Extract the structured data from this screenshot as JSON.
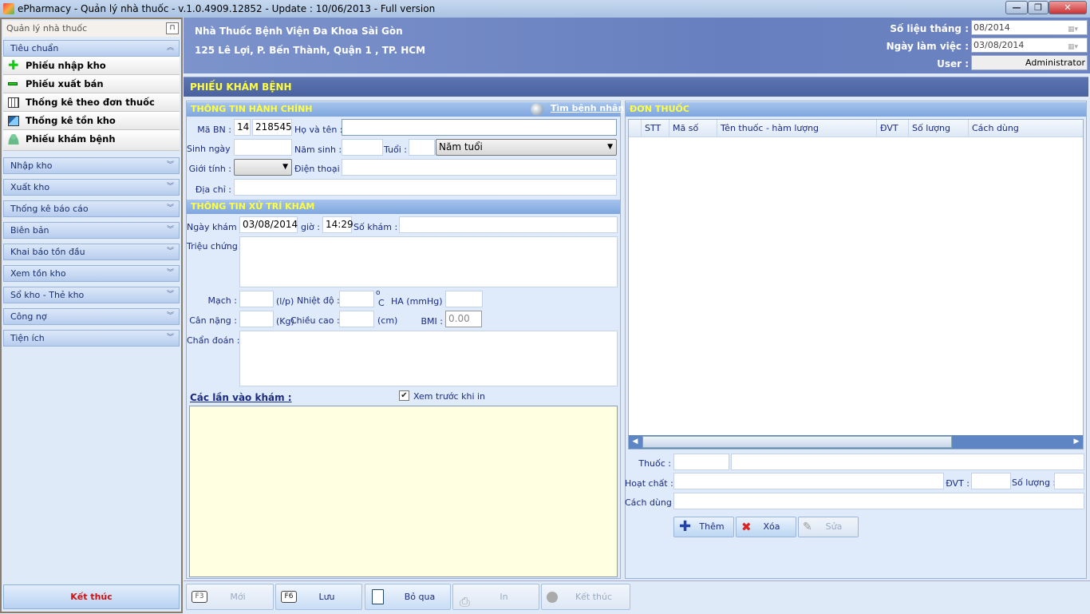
{
  "window": {
    "title": "ePharmacy - Quản lý nhà thuốc - v.1.0.4909.12852 - Update : 10/06/2013 - Full version",
    "minimize": "—",
    "restore": "❐",
    "close": "✕"
  },
  "sidebar": {
    "title": "Quản lý nhà thuốc",
    "pin": "⊓",
    "expanded_group": "Tiêu chuẩn",
    "items": [
      {
        "label": "Phiếu nhập kho",
        "icon": "plus-icon"
      },
      {
        "label": "Phiếu xuất bán",
        "icon": "minus-icon"
      },
      {
        "label": "Thống kê theo đơn thuốc",
        "icon": "table-icon"
      },
      {
        "label": "Thống kê tồn kho",
        "icon": "inventory-icon"
      },
      {
        "label": "Phiếu khám bệnh",
        "icon": "person-icon"
      }
    ],
    "groups": [
      "Nhập kho",
      "Xuất kho",
      "Thống kê báo cáo",
      "Biên bản",
      "Khai báo tồn đầu",
      "Xem tồn kho",
      "Sổ kho - Thẻ kho",
      "Công nợ",
      "Tiện ích"
    ],
    "exit": "Kết thúc"
  },
  "header": {
    "name": "Nhà Thuốc Bệnh Viện Đa Khoa Sài Gòn",
    "address": "125 Lê Lợi, P. Bến Thành, Quận 1 , TP. HCM",
    "month_label": "Số liệu tháng :",
    "month_value": "08/2014",
    "workday_label": "Ngày làm việc :",
    "workday_value": "03/08/2014",
    "user_label": "User :",
    "user_value": "Administrator"
  },
  "form_title": "PHIẾU KHÁM BỆNH",
  "admin": {
    "title": "THÔNG TIN HÀNH CHÍNH",
    "search": "Tìm bệnh nhân",
    "ma_bn_label": "Mã BN :",
    "ma_bn_prefix": "14",
    "ma_bn": "218545",
    "name_label": "Họ và tên :",
    "name": "",
    "dob_label": "Sinh ngày :",
    "yob_label": "Năm sinh :",
    "age_label": "Tuổi :",
    "age_unit": "Năm tuổi",
    "gender_label": "Giới tính :",
    "gender": "",
    "phone_label": "Điện thoại :",
    "address_label": "Địa chỉ :"
  },
  "exam": {
    "title": "THÔNG TIN XỬ TRÍ KHÁM",
    "date_label": "Ngày khám :",
    "date": "03/08/2014",
    "time_label": "giờ :",
    "time": "14:29",
    "no_label": "Số khám :",
    "symptom_label": "Triệu chứng :",
    "pulse_label": "Mạch :",
    "pulse_unit": "(l/p)",
    "temp_label": "Nhiệt độ :",
    "temp_unit_o": "o",
    "temp_unit_c": "C",
    "bp_label": "HA (mmHg) :",
    "weight_label": "Cân nặng :",
    "weight_unit": "(Kg)",
    "height_label": "Chiều cao :",
    "height_unit": "(cm)",
    "bmi_label": "BMI :",
    "bmi": "0.00",
    "diag_label": "Chẩn đoán :",
    "visits_label": "Các lần vào khám :",
    "preview_label": "Xem trước khi in",
    "preview_checked": true
  },
  "prescription": {
    "title": "ĐƠN THUỐC",
    "columns": [
      "",
      "STT",
      "Mã số",
      "Tên thuốc - hàm lượng",
      "ĐVT",
      "Số lượng",
      "Cách dùng"
    ],
    "rows": [],
    "drug_label": "Thuốc :",
    "ingredient_label": "Hoạt chất :",
    "unit_label": "ĐVT :",
    "qty_label": "Số lượng :",
    "usage_label": "Cách dùng :",
    "add": "Thêm",
    "delete": "Xóa",
    "edit": "Sửa"
  },
  "toolbar": {
    "new_key": "F3",
    "new": "Mới",
    "save_key": "F6",
    "save": "Lưu",
    "skip": "Bỏ qua",
    "print": "In",
    "exit": "Kết thúc"
  }
}
